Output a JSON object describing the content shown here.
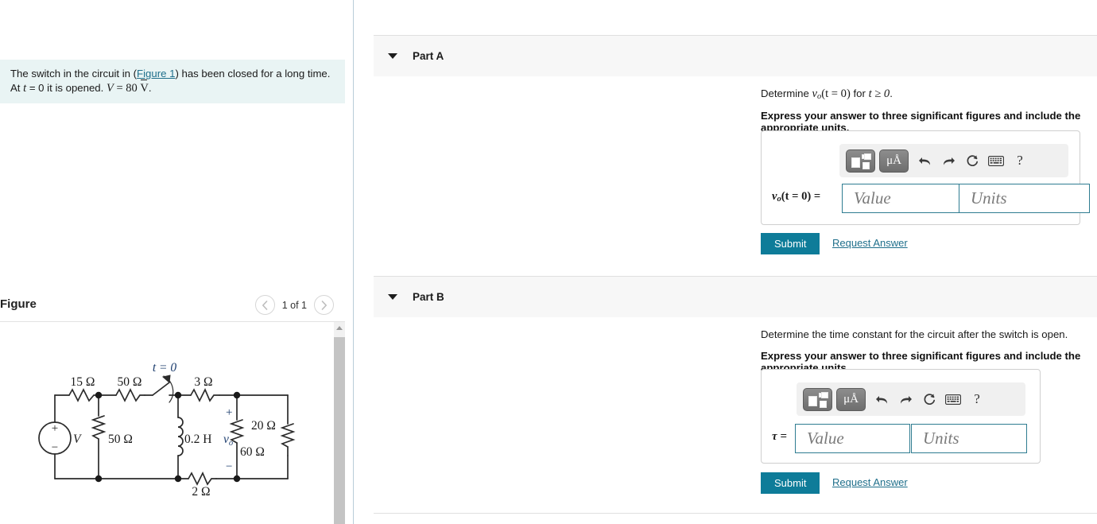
{
  "problem": {
    "text_before_link": "The switch in the circuit in (",
    "figure_link": "Figure 1",
    "text_after_link": ") has been closed for a long time.",
    "line2_prefix": "At ",
    "line2_t": "t",
    "line2_mid": " = 0 it is opened. ",
    "line2_V": "V",
    "line2_value": " = 80 ",
    "line2_unit": "V",
    "line2_suffix": "."
  },
  "figure": {
    "title": "Figure",
    "counter": "1 of 1",
    "prev_icon": "chevron-left-icon",
    "next_icon": "chevron-right-icon",
    "circuit": {
      "source_label": "V",
      "source_plus": "+",
      "source_minus": "−",
      "r15": "15 Ω",
      "r50_top": "50 Ω",
      "r50_shunt": "50 Ω",
      "switch_label": "t = 0",
      "r3": "3 Ω",
      "inductor": "0.2 H",
      "vo_label": "v",
      "vo_sub": "o",
      "vo_plus": "+",
      "vo_minus": "−",
      "r60": "60 Ω",
      "r20": "20 Ω",
      "r2": "2 Ω"
    }
  },
  "parts": [
    {
      "id": "part-a",
      "label": "Part A",
      "caret_icon": "caret-down-icon",
      "question_prefix": "Determine ",
      "question_var": "v",
      "question_sub": "o",
      "question_expr": "(t = 0)",
      "question_mid": " for ",
      "question_cond": "t ≥ 0",
      "question_suffix": ".",
      "instruction": "Express your answer to three significant figures and include the appropriate units.",
      "lhs": "v",
      "lhs_sub": "o",
      "lhs_expr": "(t = 0) =",
      "value_placeholder": "Value",
      "units_placeholder": "Units",
      "toolbar": {
        "template_icon": "math-template-icon",
        "units_icon": "micro-angstrom-units-icon",
        "units_text": "μÅ",
        "undo_icon": "undo-icon",
        "redo_icon": "redo-icon",
        "reset_icon": "reset-icon",
        "keyboard_icon": "keyboard-icon",
        "help_icon": "help-icon",
        "help_text": "?"
      },
      "submit_label": "Submit",
      "request_label": "Request Answer"
    },
    {
      "id": "part-b",
      "label": "Part B",
      "caret_icon": "caret-down-icon",
      "question_full": "Determine the time constant for the circuit after the switch is open.",
      "instruction": "Express your answer to three significant figures and include the appropriate units.",
      "lhs": "τ =",
      "value_placeholder": "Value",
      "units_placeholder": "Units",
      "toolbar": {
        "template_icon": "math-template-icon",
        "units_icon": "micro-angstrom-units-icon",
        "units_text": "μÅ",
        "undo_icon": "undo-icon",
        "redo_icon": "redo-icon",
        "reset_icon": "reset-icon",
        "keyboard_icon": "keyboard-icon",
        "help_icon": "help-icon",
        "help_text": "?"
      },
      "submit_label": "Submit",
      "request_label": "Request Answer"
    }
  ],
  "colors": {
    "accent": "#0e7c99",
    "link": "#1f6f8b",
    "statement_bg": "#e9f4f4",
    "header_bg": "#f7f7f7",
    "field_border": "#2f7c91"
  }
}
